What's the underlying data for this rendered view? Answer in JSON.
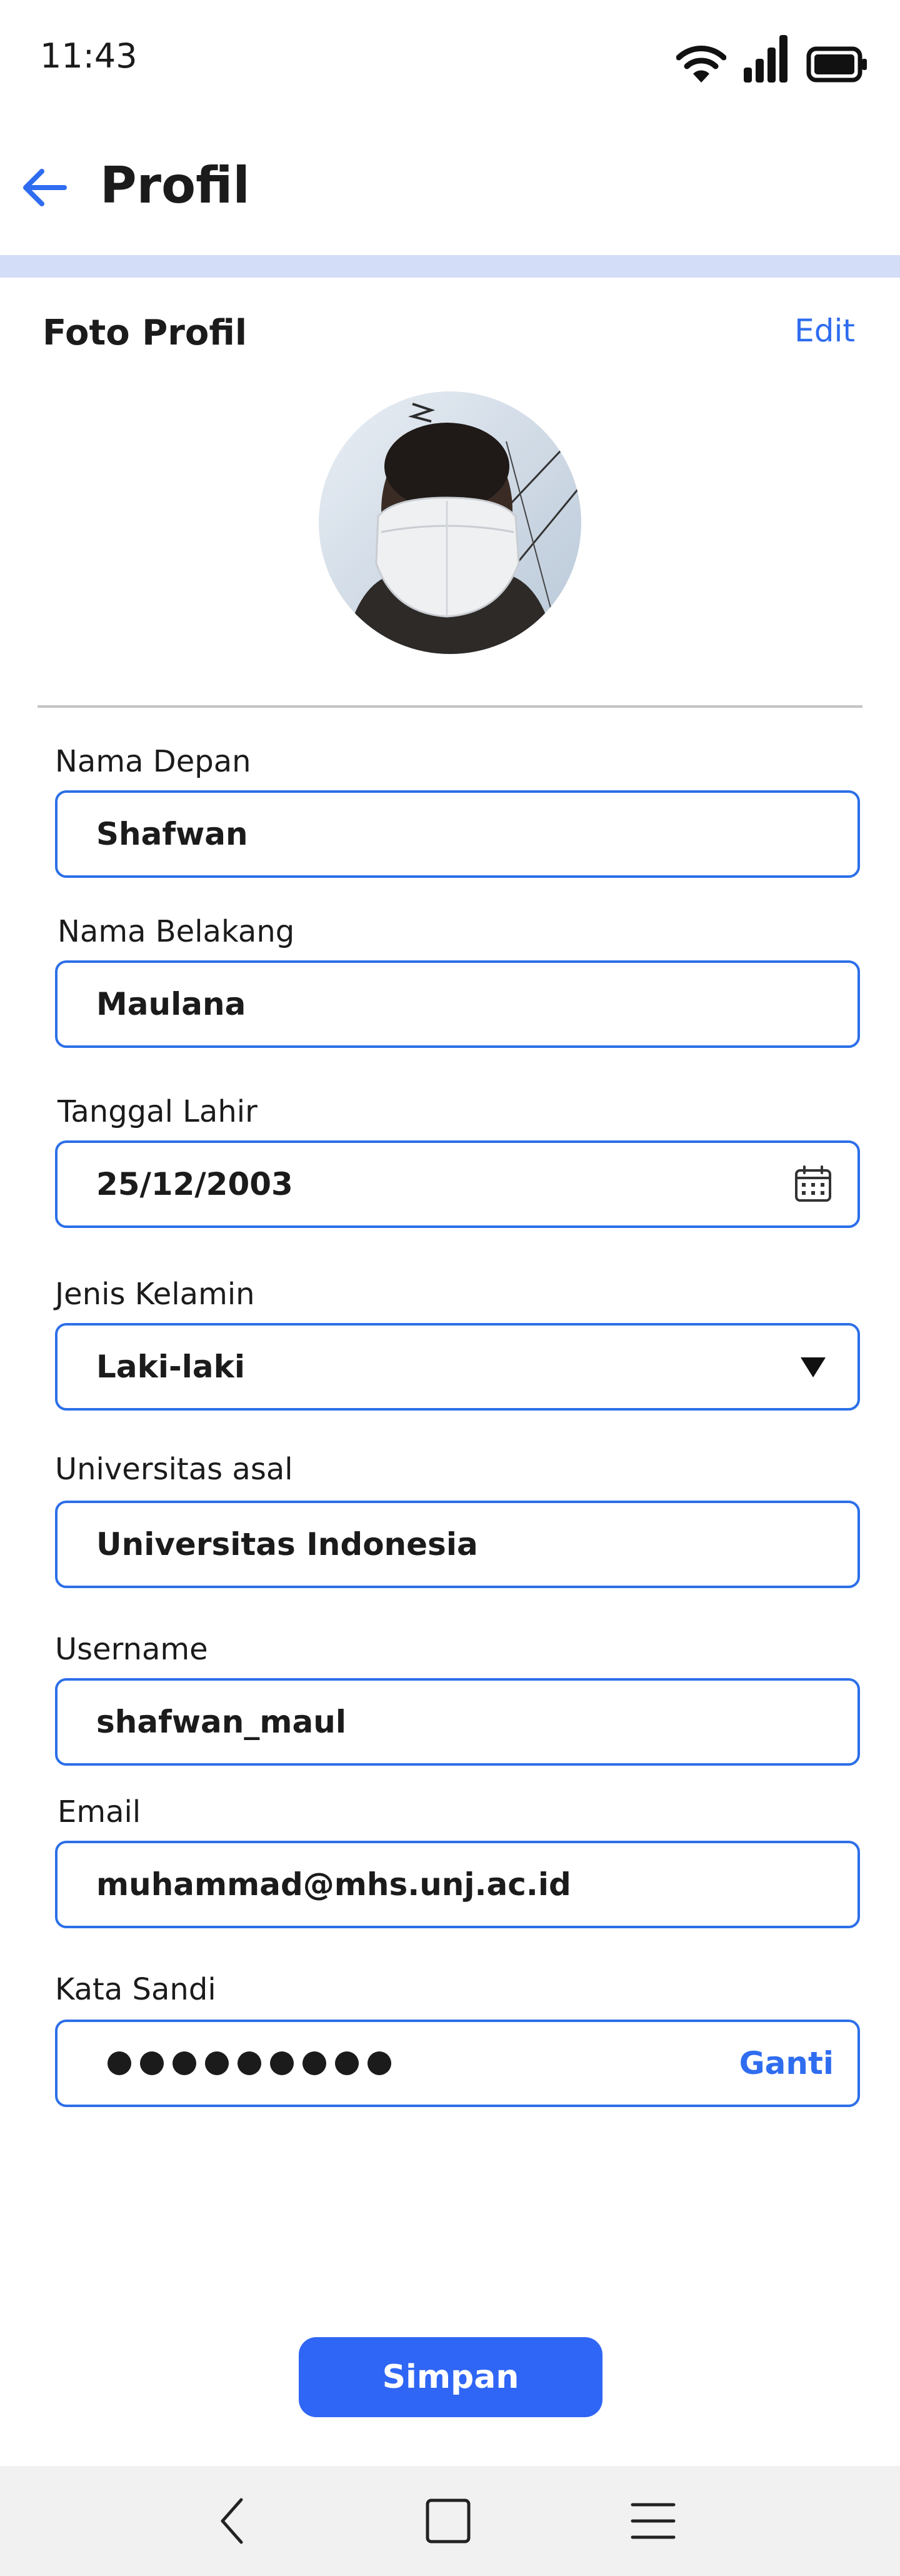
{
  "status_bar": {
    "time": "11:43",
    "icons": [
      "wifi-icon",
      "signal-icon",
      "battery-icon"
    ]
  },
  "header": {
    "title": "Profil",
    "back_icon": "arrow-left-icon"
  },
  "photo": {
    "section_title": "Foto Profil",
    "edit_label": "Edit"
  },
  "fields": {
    "first_name": {
      "label": "Nama Depan",
      "value": "Shafwan"
    },
    "last_name": {
      "label": "Nama Belakang",
      "value": "Maulana"
    },
    "birth_date": {
      "label": "Tanggal Lahir",
      "value": "25/12/2003",
      "icon": "calendar-icon"
    },
    "gender": {
      "label": "Jenis Kelamin",
      "value": "Laki-laki",
      "icon": "dropdown-triangle-icon"
    },
    "university": {
      "label": "Universitas asal",
      "value": "Universitas Indonesia"
    },
    "username": {
      "label": "Username",
      "value": "shafwan_maul"
    },
    "email": {
      "label": "Email",
      "value": "muhammad@mhs.unj.ac.id"
    },
    "password": {
      "label": "Kata Sandi",
      "masked_length": 9,
      "change_label": "Ganti"
    }
  },
  "actions": {
    "save_label": "Simpan"
  },
  "nav": {
    "icons": [
      "back-nav-icon",
      "home-nav-icon",
      "menu-nav-icon"
    ]
  },
  "colors": {
    "accent": "#2f66f5",
    "field_border": "#2c6fe8",
    "band": "#d4ddf8",
    "nav_bg": "#f1f1f1"
  }
}
